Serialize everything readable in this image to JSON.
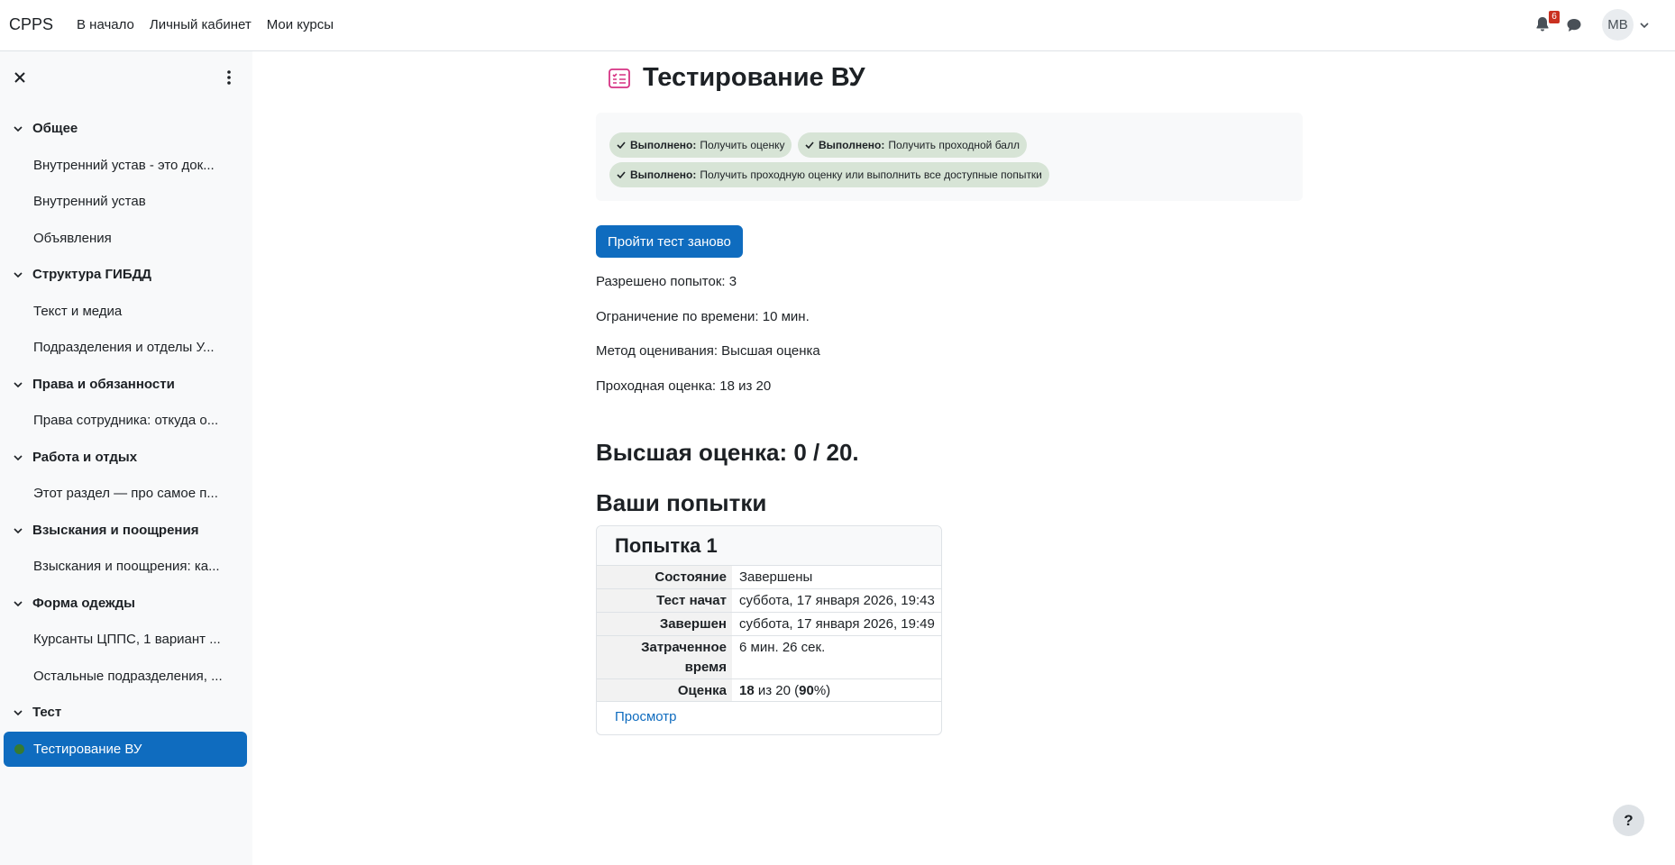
{
  "navbar": {
    "brand": "CPPS",
    "links": [
      "В начало",
      "Личный кабинет",
      "Мои курсы"
    ],
    "notifications_count": "6",
    "user_initials": "MB"
  },
  "sidebar": {
    "sections": [
      {
        "title": "Общее",
        "items": [
          "Внутренний устав - это док...",
          "Внутренний устав",
          "Объявления"
        ]
      },
      {
        "title": "Структура ГИБДД",
        "items": [
          "Текст и медиа",
          "Подразделения и отделы У..."
        ]
      },
      {
        "title": "Права и обязанности",
        "items": [
          "Права сотрудника: откуда о..."
        ]
      },
      {
        "title": "Работа и отдых",
        "items": [
          "Этот раздел — про самое п..."
        ]
      },
      {
        "title": "Взыскания и поощрения",
        "items": [
          "Взыскания и поощрения: ка..."
        ]
      },
      {
        "title": "Форма одежды",
        "items": [
          "Курсанты ЦППС, 1 вариант ...",
          "Остальные подразделения, ..."
        ]
      },
      {
        "title": "Тест",
        "items": []
      }
    ],
    "active_item": "Тестирование ВУ"
  },
  "main": {
    "title": "Тестирование ВУ",
    "completion": [
      {
        "status": "Выполнено:",
        "text": "Получить оценку"
      },
      {
        "status": "Выполнено:",
        "text": "Получить проходной балл"
      },
      {
        "status": "Выполнено:",
        "text": "Получить проходную оценку или выполнить все доступные попытки"
      }
    ],
    "retake_button": "Пройти тест заново",
    "info": [
      "Разрешено попыток: 3",
      "Ограничение по времени: 10 мин.",
      "Метод оценивания: Высшая оценка",
      "Проходная оценка: 18 из 20"
    ],
    "best_grade": "Высшая оценка: 0 / 20.",
    "attempts_heading": "Ваши попытки",
    "attempt": {
      "name": "Попытка 1",
      "rows": [
        {
          "label": "Состояние",
          "value": "Завершены"
        },
        {
          "label": "Тест начат",
          "value": "суббота, 17 января 2026, 19:43"
        },
        {
          "label": "Завершен",
          "value": "суббота, 17 января 2026, 19:49"
        },
        {
          "label": "Затраченное время",
          "value": "6 мин. 26 сек."
        }
      ],
      "grade_label": "Оценка",
      "grade_score": "18",
      "grade_mid": " из 20 (",
      "grade_percent": "90",
      "grade_tail": "%)",
      "review_link": "Просмотр"
    }
  },
  "help_label": "?"
}
